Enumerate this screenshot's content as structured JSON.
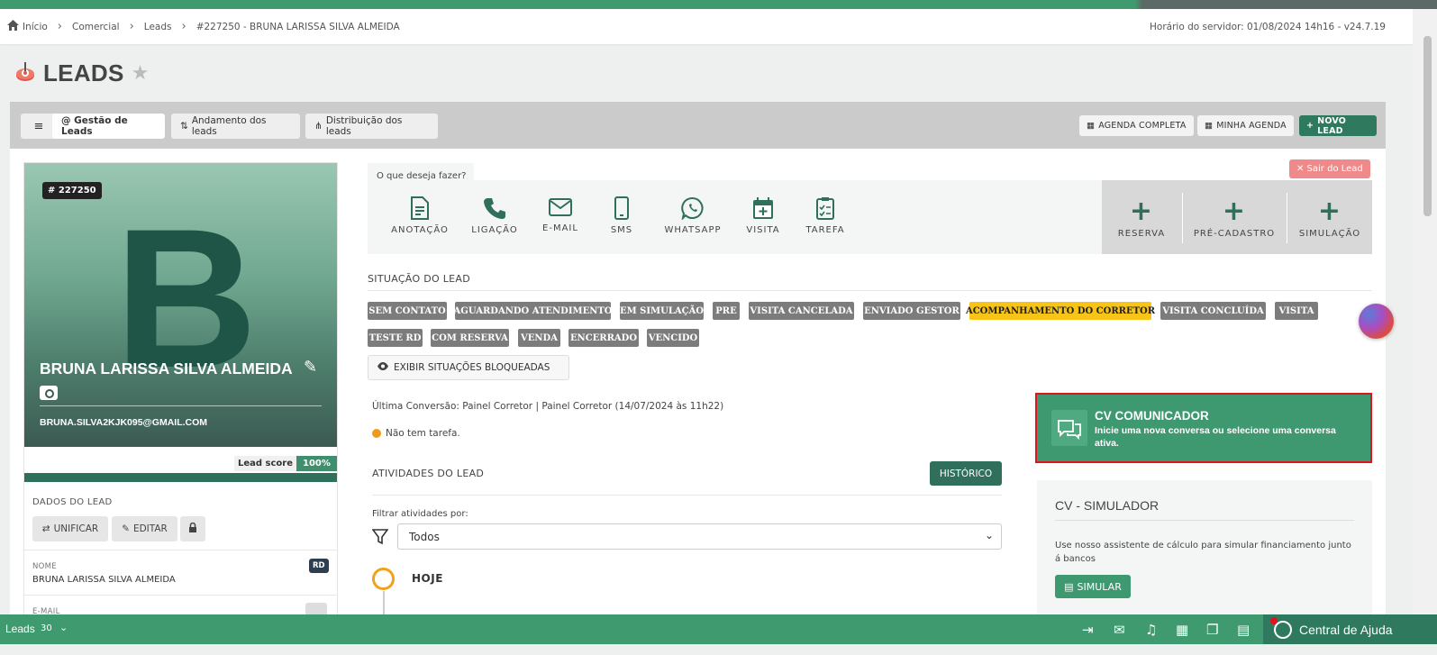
{
  "breadcrumb": {
    "items": [
      "Início",
      "Comercial",
      "Leads",
      "#227250 - BRUNA LARISSA SILVA ALMEIDA"
    ],
    "server_time": "Horário do servidor: 01/08/2024 14h16 - v24.7.19"
  },
  "page": {
    "title": "LEADS"
  },
  "toolbar": {
    "tabs": [
      {
        "label": "@ Gestão de Leads"
      },
      {
        "label": "Andamento dos leads"
      },
      {
        "label": "Distribuição dos leads"
      }
    ],
    "agenda_completa": "AGENDA COMPLETA",
    "minha_agenda": "MINHA AGENDA",
    "novo_lead": "NOVO LEAD"
  },
  "lead": {
    "id": "# 227250",
    "initial": "B",
    "name": "BRUNA LARISSA SILVA ALMEIDA",
    "email": "BRUNA.SILVA2KJK095@GMAIL.COM",
    "score_label": "Lead score",
    "score_value": "100%",
    "dados_label": "DADOS DO LEAD",
    "unificar": "UNIFICAR",
    "editar": "EDITAR",
    "fields": [
      {
        "label": "NOME",
        "value": "BRUNA LARISSA SILVA ALMEIDA",
        "badge": "RD"
      },
      {
        "label": "E-MAIL",
        "value": ""
      }
    ]
  },
  "actions": {
    "ask": "O que deseja fazer?",
    "items": [
      "ANOTAÇÃO",
      "LIGAÇÃO",
      "E-MAIL",
      "SMS",
      "WHATSAPP",
      "VISITA",
      "TAREFA"
    ],
    "right_items": [
      "RESERVA",
      "PRÉ-CADASTRO",
      "SIMULAÇÃO"
    ],
    "sair": "✕ Sair do Lead"
  },
  "situacao": {
    "header": "SITUAÇÃO DO LEAD",
    "tags_row1": [
      {
        "label": "SEM CONTATO",
        "active": false
      },
      {
        "label": "AGUARDANDO ATENDIMENTO",
        "active": false
      },
      {
        "label": "EM SIMULAÇÃO",
        "active": false
      },
      {
        "label": "PRE",
        "active": false
      },
      {
        "label": "VISITA CANCELADA",
        "active": false
      },
      {
        "label": "ENVIADO GESTOR",
        "active": false
      },
      {
        "label": "ACOMPANHAMENTO DO CORRETOR",
        "active": true
      },
      {
        "label": "VISITA CONCLUÍDA",
        "active": false
      },
      {
        "label": "VISITA",
        "active": false
      }
    ],
    "tags_row2": [
      {
        "label": "TESTE RD"
      },
      {
        "label": "COM RESERVA"
      },
      {
        "label": "VENDA"
      },
      {
        "label": "ENCERRADO"
      },
      {
        "label": "VENCIDO"
      }
    ],
    "exibir": "EXIBIR SITUAÇÕES BLOQUEADAS",
    "active_color": "#f7c417"
  },
  "info": {
    "ultima_conversao": "Última Conversão: Painel Corretor | Painel Corretor (14/07/2024 às 11h22)",
    "tarefa": "Não tem tarefa."
  },
  "atividades": {
    "header": "ATIVIDADES DO LEAD",
    "historico": "HISTÓRICO",
    "filter_label": "Filtrar atividades por:",
    "filter_value": "Todos",
    "timeline_first": "HOJE"
  },
  "cv_comunicador": {
    "title": "CV COMUNICADOR",
    "desc": "Inicie uma nova conversa ou selecione uma conversa ativa."
  },
  "simulador": {
    "title": "CV - SIMULADOR",
    "desc": "Use nosso assistente de cálculo para simular financiamento junto á bancos",
    "button": "SIMULAR"
  },
  "bottombar": {
    "module": "Leads",
    "count": "30",
    "help": "Central de Ajuda"
  },
  "colors": {
    "brand_green": "#3f9a6f",
    "dark_green": "#2f6f5c",
    "tag_gray": "#7c7c7c",
    "alert_red": "#e0141e"
  }
}
